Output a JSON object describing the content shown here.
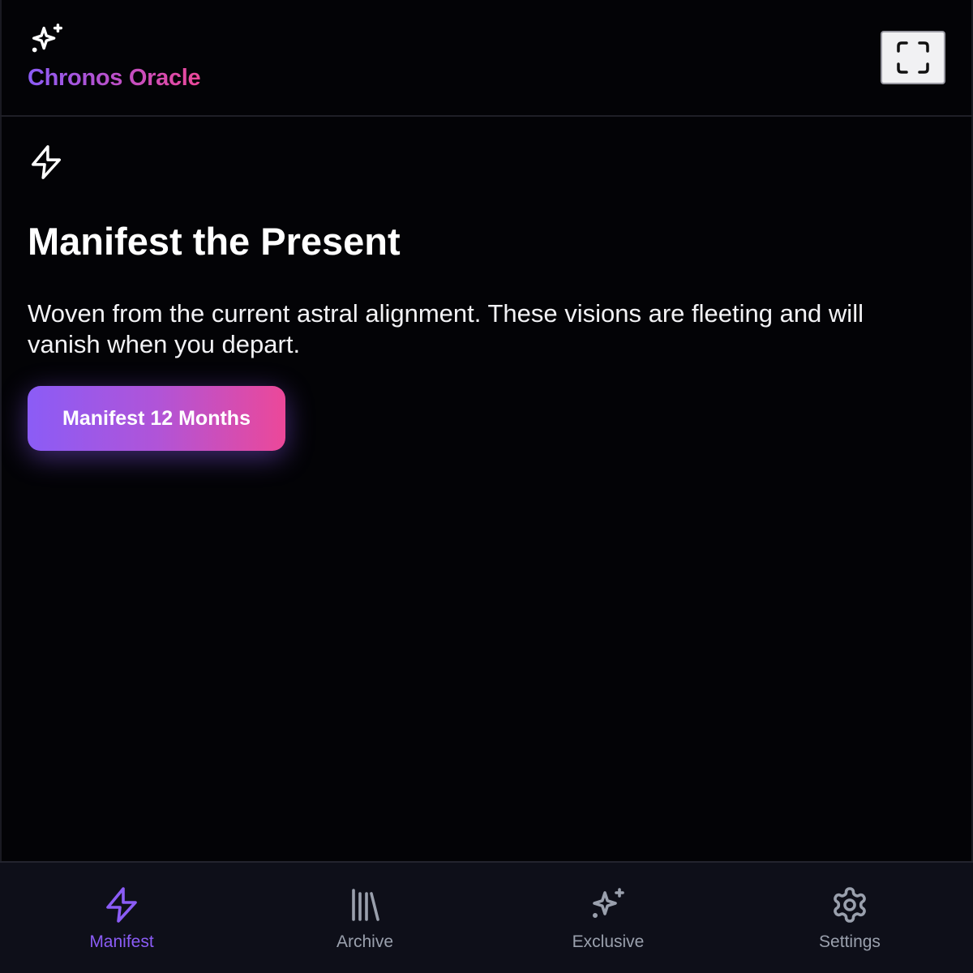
{
  "app": {
    "name": "Chronos Oracle",
    "logo_icon": "sparkles-icon",
    "fullscreen_icon": "fullscreen-icon"
  },
  "hero": {
    "icon": "lightning-bolt-icon",
    "title": "Manifest the Present",
    "description": "Woven from the current astral alignment. These visions are fleeting and will vanish when you depart.",
    "button_label": "Manifest 12 Months"
  },
  "bottom_nav": {
    "active": "Manifest",
    "items": [
      {
        "label": "Manifest",
        "icon": "lightning-bolt-icon"
      },
      {
        "label": "Archive",
        "icon": "library-icon"
      },
      {
        "label": "Exclusive",
        "icon": "sparkles-icon"
      },
      {
        "label": "Settings",
        "icon": "gear-icon"
      }
    ]
  },
  "colors": {
    "background": "#030306",
    "nav_background": "#0e0f19",
    "accent_purple": "#8b5cf6",
    "accent_pink": "#ec4899",
    "nav_inactive": "#9aa0ad"
  }
}
